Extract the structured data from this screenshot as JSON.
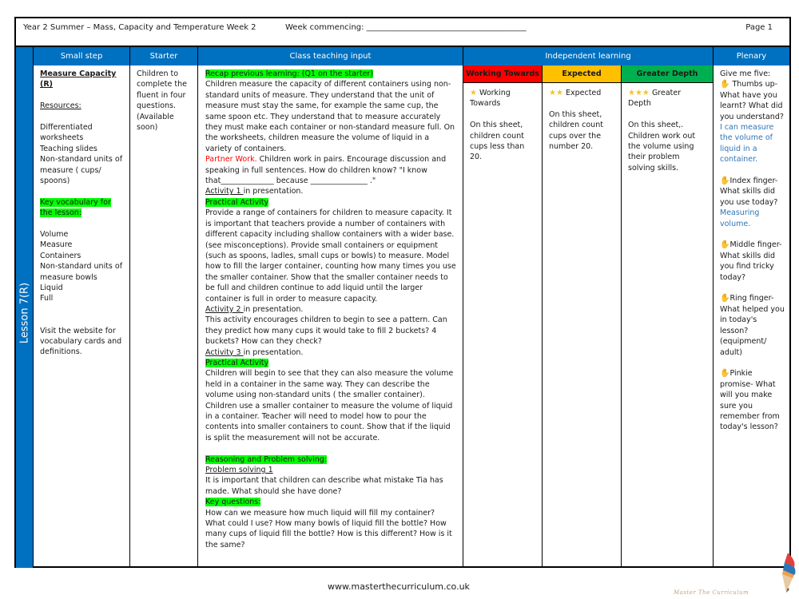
{
  "header": {
    "title": "Year 2 Summer – Mass, Capacity and Temperature Week 2",
    "week_commencing": "Week commencing: ________________________________________",
    "page": "Page 1"
  },
  "lesson_label": "Lesson 7(R)",
  "columns": {
    "small_step": "Small step",
    "starter": "Starter",
    "class_teaching": "Class teaching input",
    "independent": "Independent learning",
    "plenary": "Plenary"
  },
  "small_step": {
    "title": "Measure Capacity (R)",
    "resources_label": "Resources:",
    "resources": [
      "Differentiated worksheets",
      "Teaching slides",
      "Non-standard units of measure ( cups/ spoons)"
    ],
    "vocab_label": "Key vocabulary for the lesson:",
    "vocab": [
      "Volume",
      "Measure",
      "Containers",
      "Non-standard units of measure bowls",
      "Liquid",
      "Full"
    ],
    "website_note": "Visit the website for vocabulary cards and definitions."
  },
  "starter": {
    "text": "Children to complete the fluent in four questions. (Available soon)"
  },
  "teaching": {
    "recap_label": "Recap previous learning: (Q1 on the starter)",
    "recap_text": "Children measure the capacity of different containers using non-standard units of measure. They understand that the unit of measure must stay the same, for example the same cup, the same spoon etc. They understand that to measure accurately they must make each container or non-standard measure full. On the worksheets, children measure the volume of liquid in a variety of containers.",
    "partner_label": "Partner Work.",
    "partner_text": " Children work in pairs. Encourage discussion and speaking in full sentences. How do children know?  \"I know that______________ because _______________ .\"",
    "activity1_label": "Activity 1 ",
    "activity1_text": "in presentation.",
    "practical1_label": "Practical Activity",
    "practical1_text": "Provide a range of containers for children to measure capacity. It is important that teachers provide a number of  containers with different capacity including shallow containers with a wider base. (see misconceptions). Provide small containers or equipment (such as spoons, ladles, small cups or bowls) to measure. Model how to fill the larger container, counting how many times you use the smaller container. Show that the smaller container needs to be full and children continue to add liquid until the larger container is full in order to measure capacity.",
    "activity2_label": "Activity 2 ",
    "activity2_text": "in presentation.",
    "activity2_body": "This activity encourages children to begin to see a pattern. Can they predict how many cups it would take to fill 2 buckets?  4 buckets? How can they check?",
    "activity3_label": "Activity 3 ",
    "activity3_text": "in presentation.",
    "practical2_label": "Practical Activity",
    "practical2_text": "Children will begin to see that they can also measure the volume held in a container in the same way. They can describe the volume using non-standard units ( the smaller container). Children use a smaller container to measure the volume of liquid in a container. Teacher will need to model how to pour the contents into smaller containers to count. Show that if the liquid is split the measurement will not be accurate.",
    "reasoning_label": "Reasoning and Problem solving:",
    "problem1_label": "Problem solving 1",
    "problem1_text": "It is important that children can describe what mistake Tia has made. What should she have done?",
    "keyq_label": "Key questions:",
    "keyq_text": "How can we measure how much liquid will fill my container? What could I use? How many bowls of liquid fill the bottle? How many cups of liquid fill the bottle? How is this different? How is it the same?"
  },
  "independent": {
    "levels": [
      {
        "label": "Working Towards",
        "color": "#ff0000",
        "stars": "★",
        "title": "Working Towards",
        "text": "On this sheet, children count cups less than 20."
      },
      {
        "label": "Expected",
        "color": "#ffc000",
        "stars": "★★",
        "title": "Expected",
        "text": "On this sheet, children count cups over the number 20."
      },
      {
        "label": "Greater Depth",
        "color": "#00b050",
        "stars": "★★★",
        "title": "Greater Depth",
        "text": "On this sheet,. Children work out the volume using their problem solving skills."
      }
    ]
  },
  "plenary": {
    "intro": "Give me five:",
    "hand_icon": "✋",
    "thumbs": "Thumbs up- What have you learnt? What did you understand?",
    "thumbs_answer": "I can measure the volume of liquid in a container.",
    "index": "Index finger- What skills did you use today?",
    "index_answer": "Measuring volume.",
    "middle": "Middle finger- What skills did you find tricky today?",
    "ring": "Ring finger- What helped you in today's lesson? (equipment/ adult)",
    "pinkie": "Pinkie promise- What will you make sure you remember from today's lesson?"
  },
  "footer": {
    "url": "www.masterthecurriculum.co.uk",
    "logo_text": "Master The Curriculum"
  }
}
